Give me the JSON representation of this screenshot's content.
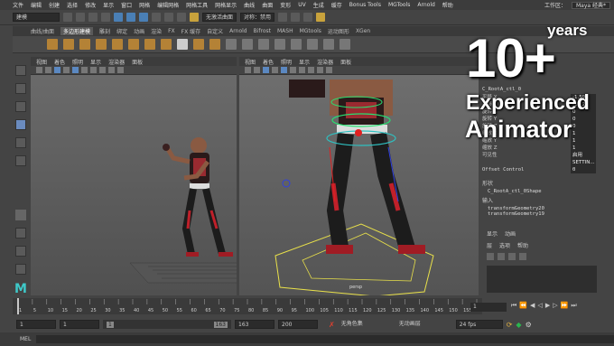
{
  "menubar": {
    "items": [
      "文件",
      "编辑",
      "创建",
      "选择",
      "修改",
      "显示",
      "窗口",
      "网格",
      "编辑网格",
      "网格工具",
      "网格显示",
      "曲线",
      "曲面",
      "变形",
      "UV",
      "生成",
      "缓存",
      "Bonus Tools",
      "MGTools",
      "Arnold",
      "帮助"
    ],
    "workspace_label": "工作区：",
    "workspace_value": "Maya 经典*"
  },
  "statusline": {
    "mode": "建模",
    "field_label": "无激活曲面",
    "symmetry": "对称：禁用"
  },
  "shelf": {
    "tabs": [
      "曲线/曲面",
      "多边形建模",
      "雕刻",
      "绑定",
      "动画",
      "渲染",
      "FX",
      "FX 缓存",
      "自定义",
      "Arnold",
      "Bifrost",
      "MASH",
      "MGtools",
      "运动图形",
      "XGen"
    ],
    "active_tab": "多边形建模"
  },
  "viewport_left": {
    "menus": [
      "视图",
      "着色",
      "照明",
      "显示",
      "渲染器",
      "面板"
    ]
  },
  "viewport_right": {
    "menus": [
      "视图",
      "着色",
      "照明",
      "显示",
      "渲染器",
      "面板"
    ],
    "camera_label": "persp"
  },
  "channel_box": {
    "object_name": "C_RootA_ctl_0",
    "rows": [
      {
        "label": "平移 X",
        "value": "-1.598"
      },
      {
        "label": "平移 Y",
        "value": "-1.222"
      },
      {
        "label": "旋转 X",
        "value": "0"
      },
      {
        "label": "旋转 Y",
        "value": "0"
      },
      {
        "label": "旋转 Z",
        "value": "0"
      },
      {
        "label": "缩放 X",
        "value": "1"
      },
      {
        "label": "缩放 Y",
        "value": "1"
      },
      {
        "label": "缩放 Z",
        "value": "1"
      },
      {
        "label": "可见性",
        "value": "启用"
      },
      {
        "label": "",
        "value": "SETTIN..."
      },
      {
        "label": "Offset Control",
        "value": "0"
      }
    ],
    "shapes_label": "形状",
    "shape_name": "C_RootA_ctl_0Shape",
    "inputs_label": "输入",
    "inputs": [
      "transformGeometry20",
      "transformGeometry19"
    ]
  },
  "layer_editor": {
    "tabs": [
      "显示",
      "动画"
    ],
    "menus": [
      "层",
      "选项",
      "帮助"
    ]
  },
  "timeline": {
    "ticks": [
      "1",
      "5",
      "10",
      "15",
      "20",
      "25",
      "30",
      "35",
      "40",
      "45",
      "50",
      "55",
      "60",
      "65",
      "70",
      "75",
      "80",
      "85",
      "90",
      "95",
      "100",
      "105",
      "110",
      "115",
      "120",
      "125",
      "130",
      "135",
      "140",
      "145",
      "150",
      "155",
      "160"
    ],
    "current_frame": "1"
  },
  "range": {
    "start": "1",
    "anim_start": "1",
    "slider_start": "1",
    "slider_end": "163",
    "anim_end": "163",
    "end": "200",
    "character_set": "无角色集",
    "anim_layer": "无动画层",
    "fps": "24 fps"
  },
  "cmdline": {
    "label": "MEL"
  },
  "overlay": {
    "big": "10+",
    "years": "years",
    "line1": "Experienced",
    "line2": "Animator"
  },
  "colors": {
    "accent_red": "#c0202a",
    "accent_yellow": "#e8e04a",
    "maya_teal": "#3ec9c9"
  }
}
